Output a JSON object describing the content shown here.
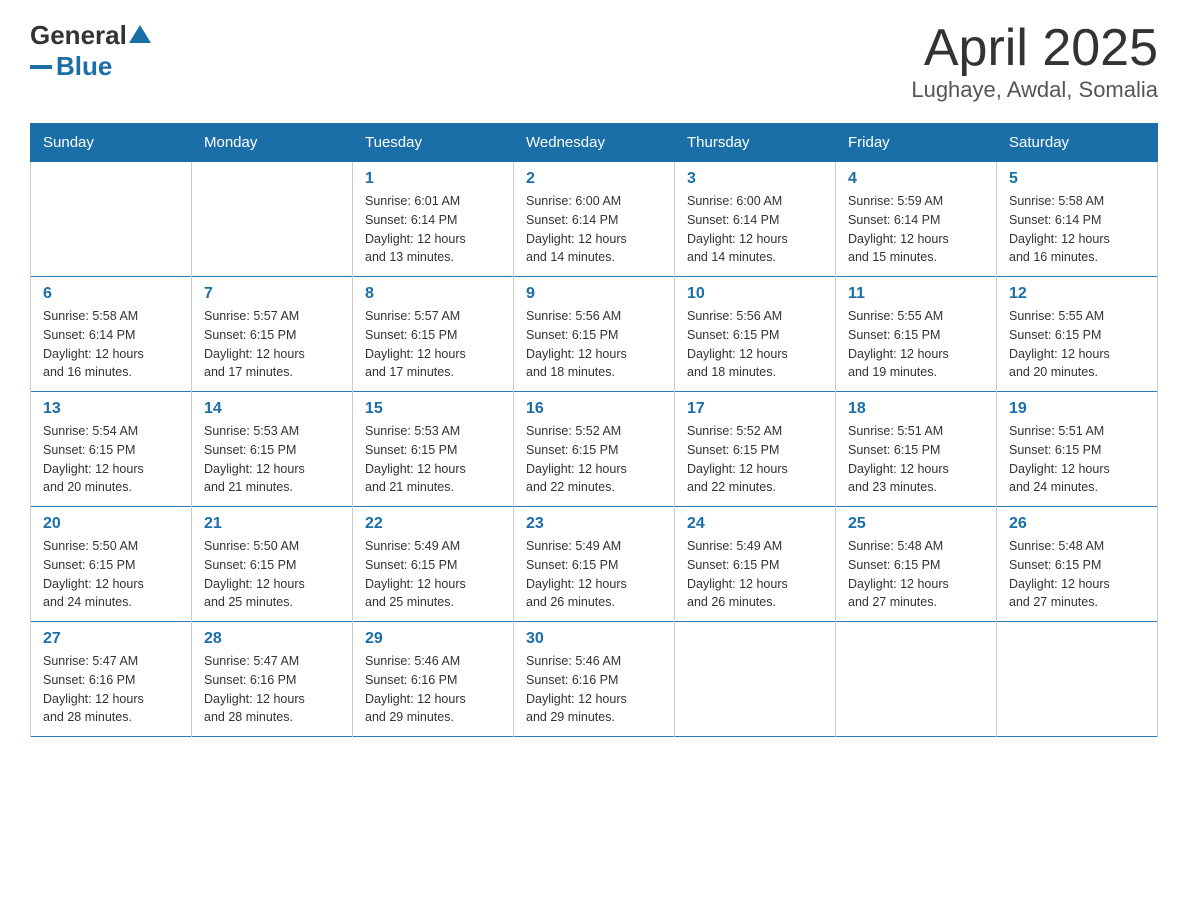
{
  "header": {
    "logo_general": "General",
    "logo_blue": "Blue",
    "title": "April 2025",
    "subtitle": "Lughaye, Awdal, Somalia"
  },
  "days_of_week": [
    "Sunday",
    "Monday",
    "Tuesday",
    "Wednesday",
    "Thursday",
    "Friday",
    "Saturday"
  ],
  "weeks": [
    [
      {
        "day": "",
        "info": ""
      },
      {
        "day": "",
        "info": ""
      },
      {
        "day": "1",
        "info": "Sunrise: 6:01 AM\nSunset: 6:14 PM\nDaylight: 12 hours\nand 13 minutes."
      },
      {
        "day": "2",
        "info": "Sunrise: 6:00 AM\nSunset: 6:14 PM\nDaylight: 12 hours\nand 14 minutes."
      },
      {
        "day": "3",
        "info": "Sunrise: 6:00 AM\nSunset: 6:14 PM\nDaylight: 12 hours\nand 14 minutes."
      },
      {
        "day": "4",
        "info": "Sunrise: 5:59 AM\nSunset: 6:14 PM\nDaylight: 12 hours\nand 15 minutes."
      },
      {
        "day": "5",
        "info": "Sunrise: 5:58 AM\nSunset: 6:14 PM\nDaylight: 12 hours\nand 16 minutes."
      }
    ],
    [
      {
        "day": "6",
        "info": "Sunrise: 5:58 AM\nSunset: 6:14 PM\nDaylight: 12 hours\nand 16 minutes."
      },
      {
        "day": "7",
        "info": "Sunrise: 5:57 AM\nSunset: 6:15 PM\nDaylight: 12 hours\nand 17 minutes."
      },
      {
        "day": "8",
        "info": "Sunrise: 5:57 AM\nSunset: 6:15 PM\nDaylight: 12 hours\nand 17 minutes."
      },
      {
        "day": "9",
        "info": "Sunrise: 5:56 AM\nSunset: 6:15 PM\nDaylight: 12 hours\nand 18 minutes."
      },
      {
        "day": "10",
        "info": "Sunrise: 5:56 AM\nSunset: 6:15 PM\nDaylight: 12 hours\nand 18 minutes."
      },
      {
        "day": "11",
        "info": "Sunrise: 5:55 AM\nSunset: 6:15 PM\nDaylight: 12 hours\nand 19 minutes."
      },
      {
        "day": "12",
        "info": "Sunrise: 5:55 AM\nSunset: 6:15 PM\nDaylight: 12 hours\nand 20 minutes."
      }
    ],
    [
      {
        "day": "13",
        "info": "Sunrise: 5:54 AM\nSunset: 6:15 PM\nDaylight: 12 hours\nand 20 minutes."
      },
      {
        "day": "14",
        "info": "Sunrise: 5:53 AM\nSunset: 6:15 PM\nDaylight: 12 hours\nand 21 minutes."
      },
      {
        "day": "15",
        "info": "Sunrise: 5:53 AM\nSunset: 6:15 PM\nDaylight: 12 hours\nand 21 minutes."
      },
      {
        "day": "16",
        "info": "Sunrise: 5:52 AM\nSunset: 6:15 PM\nDaylight: 12 hours\nand 22 minutes."
      },
      {
        "day": "17",
        "info": "Sunrise: 5:52 AM\nSunset: 6:15 PM\nDaylight: 12 hours\nand 22 minutes."
      },
      {
        "day": "18",
        "info": "Sunrise: 5:51 AM\nSunset: 6:15 PM\nDaylight: 12 hours\nand 23 minutes."
      },
      {
        "day": "19",
        "info": "Sunrise: 5:51 AM\nSunset: 6:15 PM\nDaylight: 12 hours\nand 24 minutes."
      }
    ],
    [
      {
        "day": "20",
        "info": "Sunrise: 5:50 AM\nSunset: 6:15 PM\nDaylight: 12 hours\nand 24 minutes."
      },
      {
        "day": "21",
        "info": "Sunrise: 5:50 AM\nSunset: 6:15 PM\nDaylight: 12 hours\nand 25 minutes."
      },
      {
        "day": "22",
        "info": "Sunrise: 5:49 AM\nSunset: 6:15 PM\nDaylight: 12 hours\nand 25 minutes."
      },
      {
        "day": "23",
        "info": "Sunrise: 5:49 AM\nSunset: 6:15 PM\nDaylight: 12 hours\nand 26 minutes."
      },
      {
        "day": "24",
        "info": "Sunrise: 5:49 AM\nSunset: 6:15 PM\nDaylight: 12 hours\nand 26 minutes."
      },
      {
        "day": "25",
        "info": "Sunrise: 5:48 AM\nSunset: 6:15 PM\nDaylight: 12 hours\nand 27 minutes."
      },
      {
        "day": "26",
        "info": "Sunrise: 5:48 AM\nSunset: 6:15 PM\nDaylight: 12 hours\nand 27 minutes."
      }
    ],
    [
      {
        "day": "27",
        "info": "Sunrise: 5:47 AM\nSunset: 6:16 PM\nDaylight: 12 hours\nand 28 minutes."
      },
      {
        "day": "28",
        "info": "Sunrise: 5:47 AM\nSunset: 6:16 PM\nDaylight: 12 hours\nand 28 minutes."
      },
      {
        "day": "29",
        "info": "Sunrise: 5:46 AM\nSunset: 6:16 PM\nDaylight: 12 hours\nand 29 minutes."
      },
      {
        "day": "30",
        "info": "Sunrise: 5:46 AM\nSunset: 6:16 PM\nDaylight: 12 hours\nand 29 minutes."
      },
      {
        "day": "",
        "info": ""
      },
      {
        "day": "",
        "info": ""
      },
      {
        "day": "",
        "info": ""
      }
    ]
  ]
}
